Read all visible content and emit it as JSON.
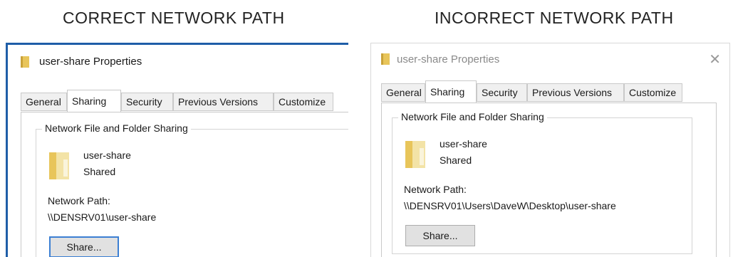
{
  "headings": {
    "left": "CORRECT NETWORK PATH",
    "right": "INCORRECT NETWORK PATH"
  },
  "dialog": {
    "title": "user-share Properties",
    "tabs": [
      "General",
      "Sharing",
      "Security",
      "Previous Versions",
      "Customize"
    ],
    "active_tab": "Sharing",
    "group_label": "Network File and Folder Sharing",
    "share_name": "user-share",
    "share_status": "Shared",
    "network_path_label": "Network Path:",
    "share_button": "Share..."
  },
  "left_panel": {
    "network_path": "\\\\DENSRV01\\user-share"
  },
  "right_panel": {
    "network_path": "\\\\DENSRV01\\Users\\DaveW\\Desktop\\user-share"
  },
  "colors": {
    "accent": "#1f5ea8",
    "folder": "#e8c55a"
  }
}
